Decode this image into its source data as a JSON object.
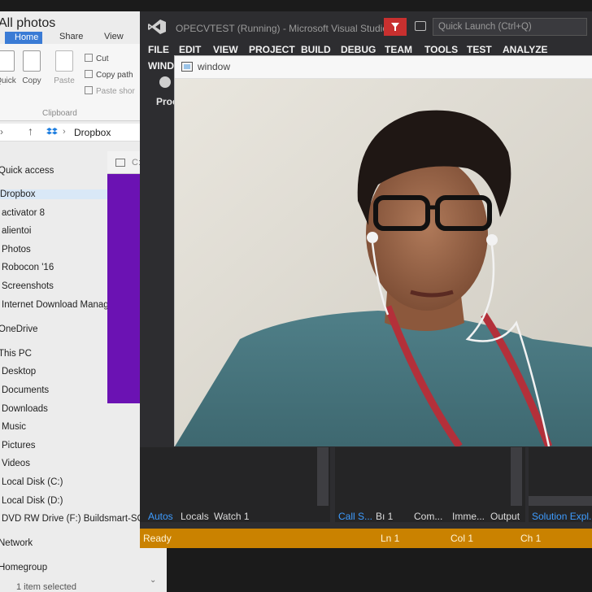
{
  "explorer": {
    "title": "All photos",
    "ribbon_tabs": [
      "Home",
      "Share",
      "View"
    ],
    "ribbon": {
      "quick_access_label": "Quick",
      "copy_label": "Copy",
      "paste_label": "Paste",
      "cut_label": "Cut",
      "copy_path_label": "Copy path",
      "paste_shortcut_label": "Paste shor",
      "group_label": "Clipboard"
    },
    "address": {
      "path": "Dropbox"
    },
    "nav": {
      "quick_access": "Quick access",
      "dropbox": "Dropbox",
      "items": [
        "activator 8",
        "alientoi",
        "Photos",
        "Robocon '16",
        "Screenshots",
        "Internet Download Manag"
      ],
      "onedrive": "OneDrive",
      "this_pc": "This PC",
      "pc_items": [
        "Desktop",
        "Documents",
        "Downloads",
        "Music",
        "Pictures",
        "Videos",
        "Local Disk (C:)",
        "Local Disk (D:)",
        "DVD RW Drive (F:) Buildsmart-SON"
      ],
      "network": "Network",
      "homegroup": "Homegroup"
    },
    "status": "1 item selected"
  },
  "console": {
    "title": "C:\\Users\\D"
  },
  "vs": {
    "title": "OPECVTEST (Running) - Microsoft Visual Studio",
    "quick_launch": "Quick Launch (Ctrl+Q)",
    "menu": [
      "FILE",
      "EDIT",
      "VIEW",
      "PROJECT",
      "BUILD",
      "DEBUG",
      "TEAM",
      "TOOLS",
      "TEST",
      "ANALYZE"
    ],
    "menu_row2": "WINDOW",
    "process_label": "Proc",
    "left_tabs": [
      "Autos",
      "Locals",
      "Watch 1"
    ],
    "mid_tabs": [
      "Call S...",
      "Bı 1",
      "Com...",
      "Imme...",
      "Output"
    ],
    "right_tab": "Solution Expl...",
    "status": {
      "ready": "Ready",
      "ln": "Ln 1",
      "col": "Col 1",
      "ch": "Ch 1"
    },
    "colors": {
      "status_bar": "#ca8200",
      "tab_active": "#3e9cff",
      "bg": "#2d2d30"
    }
  },
  "camera_window": {
    "title": "window"
  },
  "colors": {
    "console_bg": "#6b12b3",
    "explorer_bg": "#ececec"
  }
}
